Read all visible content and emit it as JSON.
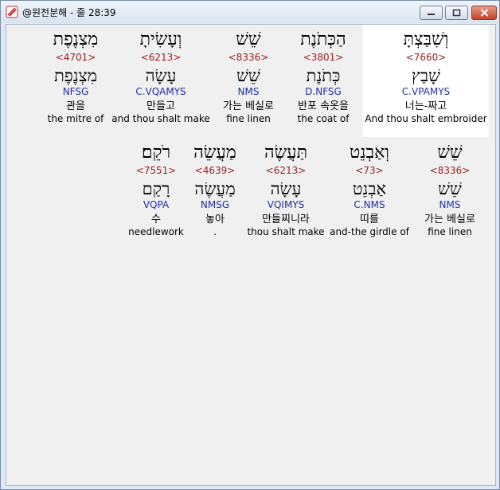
{
  "window": {
    "title": "@원전분해 - 줄 28:39"
  },
  "rows": [
    {
      "words": [
        {
          "heb": "וְשִׁבַּצְתָּ",
          "num": "<7660>",
          "lemma": "שָׁבַץ",
          "gram": "C.VPAMYS",
          "ko": "너는-짜고",
          "en": "And thou shalt embroider",
          "highlight": true
        },
        {
          "heb": "הַכְּתֹנֶת",
          "num": "<3801>",
          "lemma": "כְּתֹנֶת",
          "gram": "D.NFSG",
          "ko": "반포 속옷을",
          "en": "the coat of"
        },
        {
          "heb": "שֵׁשׁ",
          "num": "<8336>",
          "lemma": "שֵׁשׁ",
          "gram": "NMS",
          "ko": "가는 베실로",
          "en": "fine linen"
        },
        {
          "heb": "וְעָשִׂיתָ",
          "num": "<6213>",
          "lemma": "עָשָׂה",
          "gram": "C.VQAMYS",
          "ko": "만들고",
          "en": "and thou shalt make"
        },
        {
          "heb": "מִצְנֶפֶת",
          "num": "<4701>",
          "lemma": "מִצְנֶפֶת",
          "gram": "NFSG",
          "ko": "관을",
          "en": "the mitre of"
        }
      ]
    },
    {
      "words": [
        {
          "heb": "שֵׁשׁ",
          "num": "<8336>",
          "lemma": "שֵׁשׁ",
          "gram": "NMS",
          "ko": "가는 베실로",
          "en": "fine linen"
        },
        {
          "heb": "וְאַבְנֵט",
          "num": "<73>",
          "lemma": "אַבְנֵט",
          "gram": "C.NMS",
          "ko": "띠를",
          "en": "and-the girdle of"
        },
        {
          "heb": "תַּעֲשֶׂה",
          "num": "<6213>",
          "lemma": "עָשָׂה",
          "gram": "VQIMYS",
          "ko": "만들찌니라",
          "en": "thou shalt make"
        },
        {
          "heb": "מַעֲשֵׂה",
          "num": "<4639>",
          "lemma": "מַעֲשֶׂה",
          "gram": "NMSG",
          "ko": "놓아",
          "en": "."
        },
        {
          "heb": "רֹקֵם׃",
          "num": "<7551>",
          "lemma": "רָקַם",
          "gram": "VQPA",
          "ko": "수",
          "en": "needlework"
        }
      ]
    }
  ]
}
